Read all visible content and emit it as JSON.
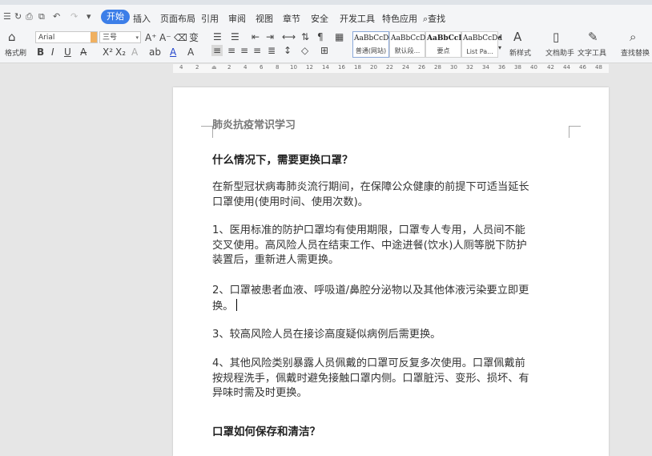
{
  "menubar": {
    "tabs": [
      {
        "label": "开始",
        "active": true
      },
      {
        "label": "插入"
      },
      {
        "label": "页面布局"
      },
      {
        "label": "引用"
      },
      {
        "label": "审阅"
      },
      {
        "label": "视图"
      },
      {
        "label": "章节"
      },
      {
        "label": "安全"
      },
      {
        "label": "开发工具"
      },
      {
        "label": "特色应用"
      }
    ],
    "search_label": "查找"
  },
  "ribbon": {
    "format_painter_label": "格式刷",
    "font_name": "Arial",
    "font_size": "三号",
    "styles": [
      {
        "preview": "AaBbCcDd",
        "name": "普通(网站)"
      },
      {
        "preview": "AaBbCcDd",
        "name": "默认段..."
      },
      {
        "preview": "AaBbCcDd",
        "name": "要点"
      },
      {
        "preview": "AaBbCcDd",
        "name": "List Pa..."
      }
    ],
    "new_style_label": "新样式",
    "doc_assistant_label": "文档助手",
    "text_tools_label": "文字工具",
    "find_replace_label": "查找替换",
    "accent_color": "#3c7ee8"
  },
  "ruler": {
    "ticks": [
      "4",
      "2",
      "2",
      "4",
      "6",
      "8",
      "10",
      "12",
      "14",
      "16",
      "18",
      "20",
      "22",
      "24",
      "26",
      "28",
      "30",
      "32",
      "34",
      "36",
      "38",
      "40",
      "42",
      "44",
      "46",
      "48"
    ]
  },
  "document": {
    "title": "肺炎抗疫常识学习",
    "heading1": "什么情况下，需要更换口罩？",
    "p1": [
      "在新型冠状病毒肺炎流行期间，在保障公众健康的前提下可适当延长",
      "口罩使用(使用时间、使用次数)。"
    ],
    "p2": [
      "1、医用标准的防护口罩均有使用期限，口罩专人专用，人员间不能",
      "交叉使用。高风险人员在结束工作、中途进餐(饮水)人厕等脱下防护",
      "装置后，重新进人需更换。"
    ],
    "p3": [
      "2、口罩被患者血液、呼吸道/鼻腔分泌物以及其他体液污染要立即更",
      "换。"
    ],
    "p4": [
      "3、较高风险人员在接诊高度疑似病例后需更换。"
    ],
    "p5": [
      "4、其他风险类别暴露人员佩戴的口罩可反复多次使用。口罩佩戴前",
      "按规程洗手，佩戴时避免接触口罩内侧。口罩脏污、变形、损坏、有",
      "异味时需及时更换。"
    ],
    "heading2": "口罩如何保存和清洁？"
  }
}
